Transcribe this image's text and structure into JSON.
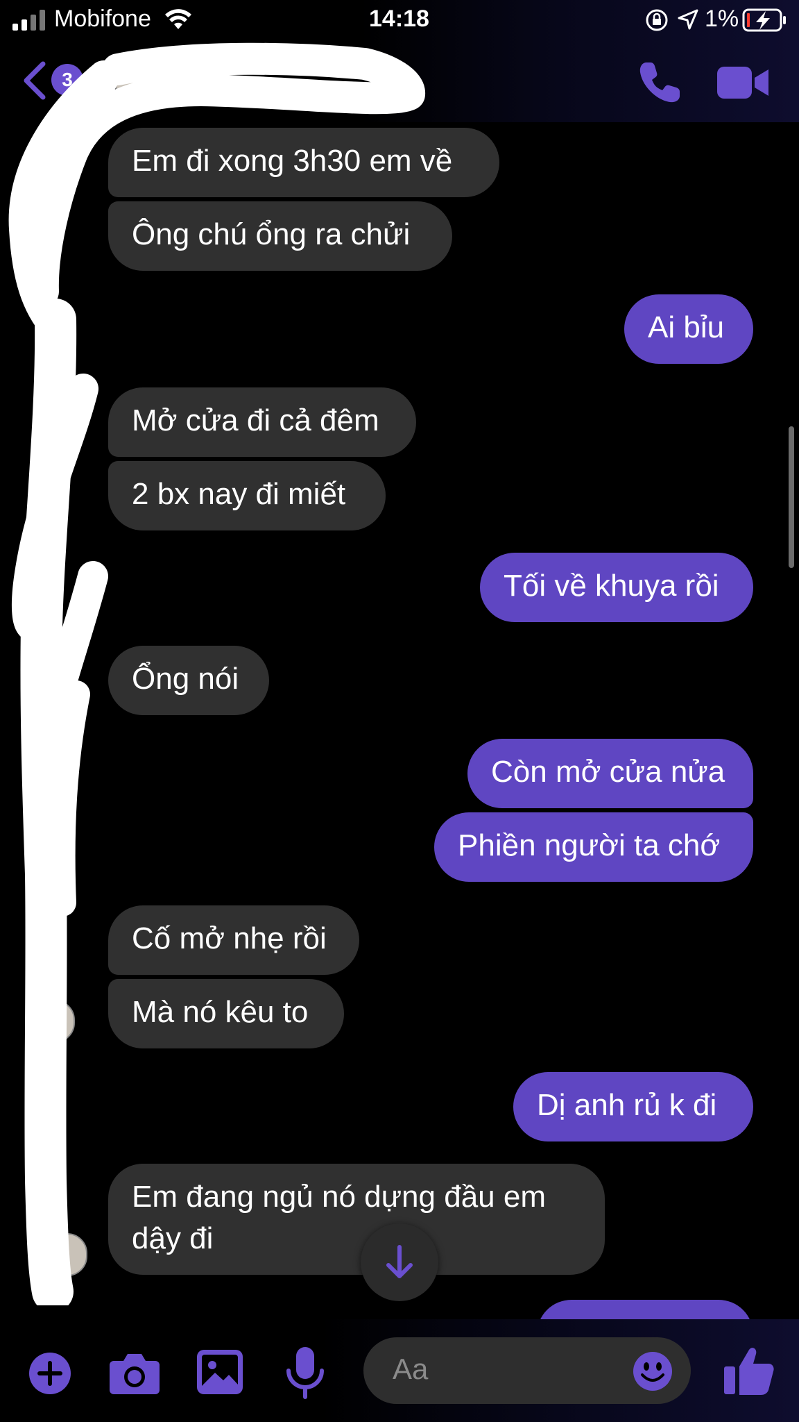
{
  "status_bar": {
    "carrier": "Mobifone",
    "time": "14:18",
    "battery_percent": "1%"
  },
  "header": {
    "unread_count": "3",
    "icons": [
      "back-chevron-icon",
      "phone-icon",
      "video-camera-icon"
    ]
  },
  "messages": [
    {
      "from": "them",
      "text": "Em đi xong 3h30 em về"
    },
    {
      "from": "them",
      "text": "Ông chú ổng ra chửi"
    },
    {
      "from": "me",
      "text": "Ai bỉu"
    },
    {
      "from": "them",
      "text": "Mở cửa đi cả đêm"
    },
    {
      "from": "them",
      "text": "2 bx nay đi miết"
    },
    {
      "from": "me",
      "text": "Tối về khuya rồi"
    },
    {
      "from": "them",
      "text": "Ổng nói"
    },
    {
      "from": "me",
      "text": "Còn mở cửa nửa"
    },
    {
      "from": "me",
      "text": "Phiền người ta chớ"
    },
    {
      "from": "them",
      "text": "Cố mở nhẹ rồi"
    },
    {
      "from": "them",
      "text": "Mà nó kêu to"
    },
    {
      "from": "me",
      "text": "Dị anh rủ k đi"
    },
    {
      "from": "them",
      "text_line1": "Em đang ngủ nó dựng đầu em",
      "text_line2": "dậy đi"
    }
  ],
  "composer": {
    "placeholder": "Aa",
    "icons": [
      "plus-icon",
      "camera-icon",
      "image-icon",
      "microphone-icon",
      "emoji-icon",
      "thumbs-up-icon"
    ]
  },
  "colors": {
    "accent": "#6a4fcf",
    "sent_bubble": "#5f46c2",
    "received_bubble": "#303030",
    "background": "#000000"
  }
}
